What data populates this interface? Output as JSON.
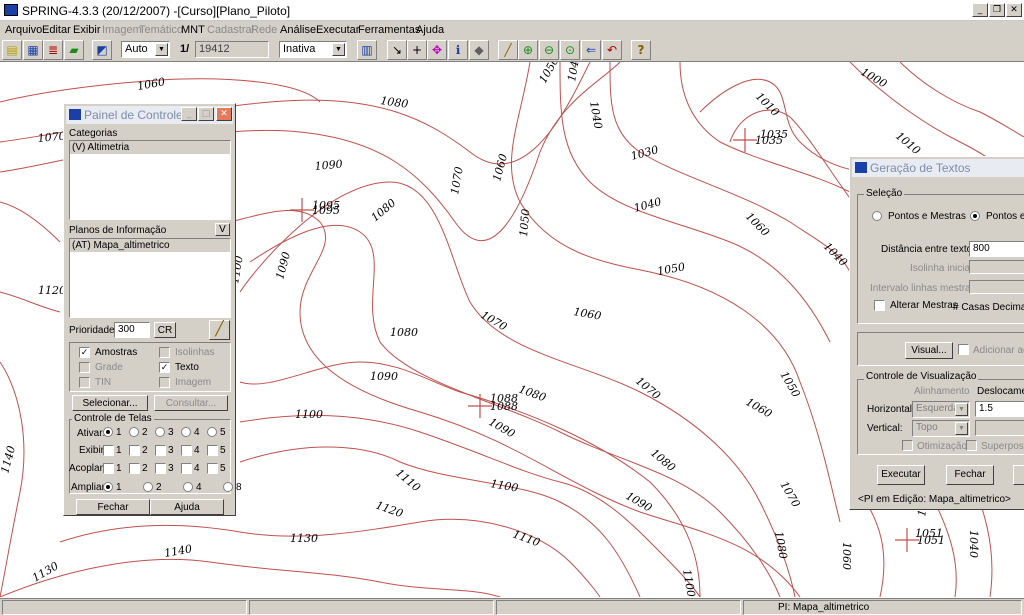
{
  "window": {
    "title": "SPRING-4.3.3 (20/12/2007) -[Curso][Plano_Piloto]"
  },
  "menu": [
    "Arquivo",
    "Editar",
    "Exibir",
    "Imagem",
    "Temático",
    "MNT",
    "Cadastral",
    "Rede",
    "Análise",
    "Executar",
    "Ferramentas",
    "Ajuda"
  ],
  "toolbar": {
    "zoom_mode": "Auto",
    "scale_prefix": "1/",
    "scale_value": "19412",
    "cursor_mode": "Inativa"
  },
  "map": {
    "contour_labels": [
      "1060",
      "1080",
      "1070",
      "1050",
      "1040",
      "1040",
      "1030",
      "1010",
      "1000",
      "1035",
      "1010",
      "1090",
      "1070",
      "1060",
      "1095",
      "1080",
      "1050",
      "1040",
      "1040",
      "1100",
      "1090",
      "1050",
      "1120",
      "1080",
      "1070",
      "1060",
      "1060",
      "1090",
      "1080",
      "1070",
      "1050",
      "1088",
      "1060",
      "1100",
      "1090",
      "1080",
      "1110",
      "1100",
      "1090",
      "1070",
      "1140",
      "1130",
      "1120",
      "1110",
      "1080",
      "1060",
      "1050",
      "1051",
      "1040",
      "1140",
      "1130",
      "1100"
    ],
    "spot_heights": [
      "1035",
      "1095",
      "1088",
      "1051"
    ],
    "colors": {
      "contour": "#c0504d",
      "marker": "#c0504d"
    }
  },
  "status": {
    "left": "",
    "mid1": "",
    "mid2": "",
    "pi": "PI: Mapa_altimetrico"
  },
  "painel": {
    "title": "Painel de Controle",
    "categorias_label": "Categorias",
    "categoria_selected": "(V) Altimetria",
    "planos_label": "Planos de Informação",
    "planos_filter": "V",
    "plano_selected": "(AT) Mapa_altimetrico",
    "prioridade_label": "Prioridade:",
    "prioridade_value": "300",
    "cr_label": "CR",
    "checks": {
      "amostras": "Amostras",
      "grade": "Grade",
      "tin": "TIN",
      "isolinhas": "Isolinhas",
      "texto": "Texto",
      "imagem": "Imagem"
    },
    "selecionar": "Selecionar...",
    "consultar": "Consultar...",
    "controle_telas": "Controle de Telas",
    "ativar": "Ativar:",
    "exibir": "Exibir:",
    "acoplar": "Acoplar:",
    "ampliar": "Ampliar:",
    "nums": [
      "1",
      "2",
      "3",
      "4",
      "5"
    ],
    "ampliar_nums": [
      "1",
      "2",
      "4",
      "8"
    ],
    "fechar": "Fechar",
    "ajuda": "Ajuda"
  },
  "geracao": {
    "title": "Geração de Textos",
    "selecao": "Seleção",
    "pontos_mestras": "Pontos e Mestras",
    "pontos_i": "Pontos e I",
    "distancia_label": "Distância entre textos:",
    "distancia_value": "800",
    "isolinha_inicial": "Isolinha inicial:",
    "intervalo_mestras": "Intervalo linhas mestras:",
    "alterar_mestras": "Alterar Mestras",
    "casas_decimais": "# Casas Decimais:",
    "visual": "Visual...",
    "adicionar": "Adicionar ao",
    "controle_vis": "Controle de Visualização",
    "alinhamento": "Alinhamento",
    "deslocamento": "Deslocament",
    "horizontal": "Horizontal:",
    "horiz_value": "Esquerda",
    "desloc_value": "1.5",
    "vertical": "Vertical:",
    "vert_value": "Topo",
    "otimizacao": "Otimização",
    "superposicao": "Superposiç",
    "executar": "Executar",
    "fechar": "Fechar",
    "status": "<PI em Edição: Mapa_altimetrico>"
  }
}
